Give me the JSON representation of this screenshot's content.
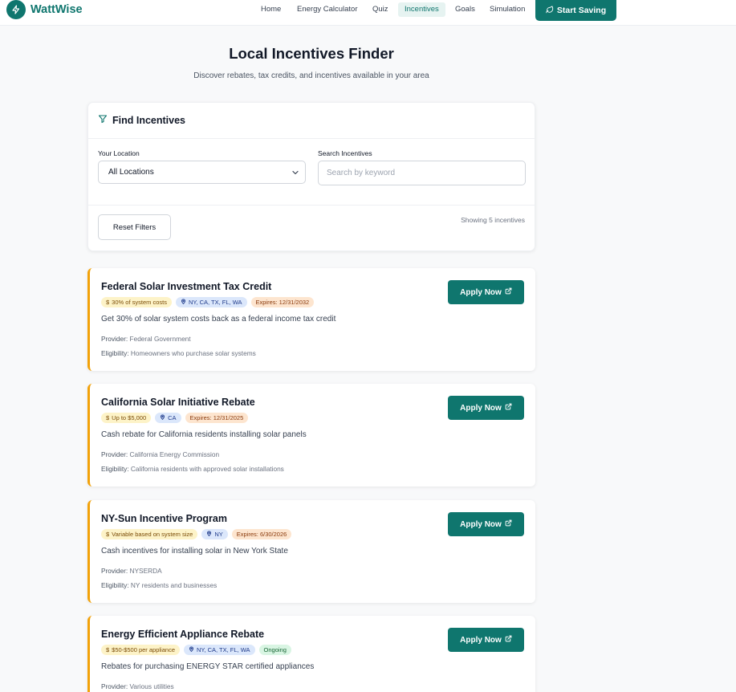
{
  "brand": {
    "name": "WattWise"
  },
  "nav": {
    "links": [
      "Home",
      "Energy Calculator",
      "Quiz",
      "Incentives",
      "Goals",
      "Simulation"
    ],
    "active": "Incentives",
    "cta_label": "Start Saving"
  },
  "page": {
    "title": "Local Incentives Finder",
    "subtitle": "Discover rebates, tax credits, and incentives available in your area"
  },
  "filters": {
    "heading": "Find Incentives",
    "location_label": "Your Location",
    "location_value": "All Locations",
    "search_label": "Search Incentives",
    "search_placeholder": "Search by keyword",
    "reset_label": "Reset Filters",
    "count_text": "Showing 5 incentives"
  },
  "incentives": [
    {
      "title": "Federal Solar Investment Tax Credit",
      "amount": "30% of system costs",
      "locations": "NY, CA, TX, FL, WA",
      "expiry": "Expires: 12/31/2032",
      "description": "Get 30% of solar system costs back as a federal income tax credit",
      "provider_label": "Provider:",
      "provider": "Federal Government",
      "eligibility_label": "Eligibility:",
      "eligibility": "Homeowners who purchase solar systems",
      "apply_label": "Apply Now"
    },
    {
      "title": "California Solar Initiative Rebate",
      "amount": "Up to $5,000",
      "locations": "CA",
      "expiry": "Expires: 12/31/2025",
      "description": "Cash rebate for California residents installing solar panels",
      "provider_label": "Provider:",
      "provider": "California Energy Commission",
      "eligibility_label": "Eligibility:",
      "eligibility": "California residents with approved solar installations",
      "apply_label": "Apply Now"
    },
    {
      "title": "NY-Sun Incentive Program",
      "amount": "Variable based on system size",
      "locations": "NY",
      "expiry": "Expires: 6/30/2026",
      "description": "Cash incentives for installing solar in New York State",
      "provider_label": "Provider:",
      "provider": "NYSERDA",
      "eligibility_label": "Eligibility:",
      "eligibility": "NY residents and businesses",
      "apply_label": "Apply Now"
    },
    {
      "title": "Energy Efficient Appliance Rebate",
      "amount": "$50-$500 per appliance",
      "locations": "NY, CA, TX, FL, WA",
      "expiry": "Ongoing",
      "description": "Rebates for purchasing ENERGY STAR certified appliances",
      "provider_label": "Provider:",
      "provider": "Various utilities",
      "apply_label": "Apply Now"
    }
  ],
  "colors": {
    "brand": "#0f766e",
    "accent_border": "#f2a20a",
    "amount_tag_bg": "#fdf3c8",
    "location_tag_bg": "#dbe7fb",
    "expiry_tag_bg": "#fde5cf",
    "ongoing_tag_bg": "#d9f5e3"
  }
}
